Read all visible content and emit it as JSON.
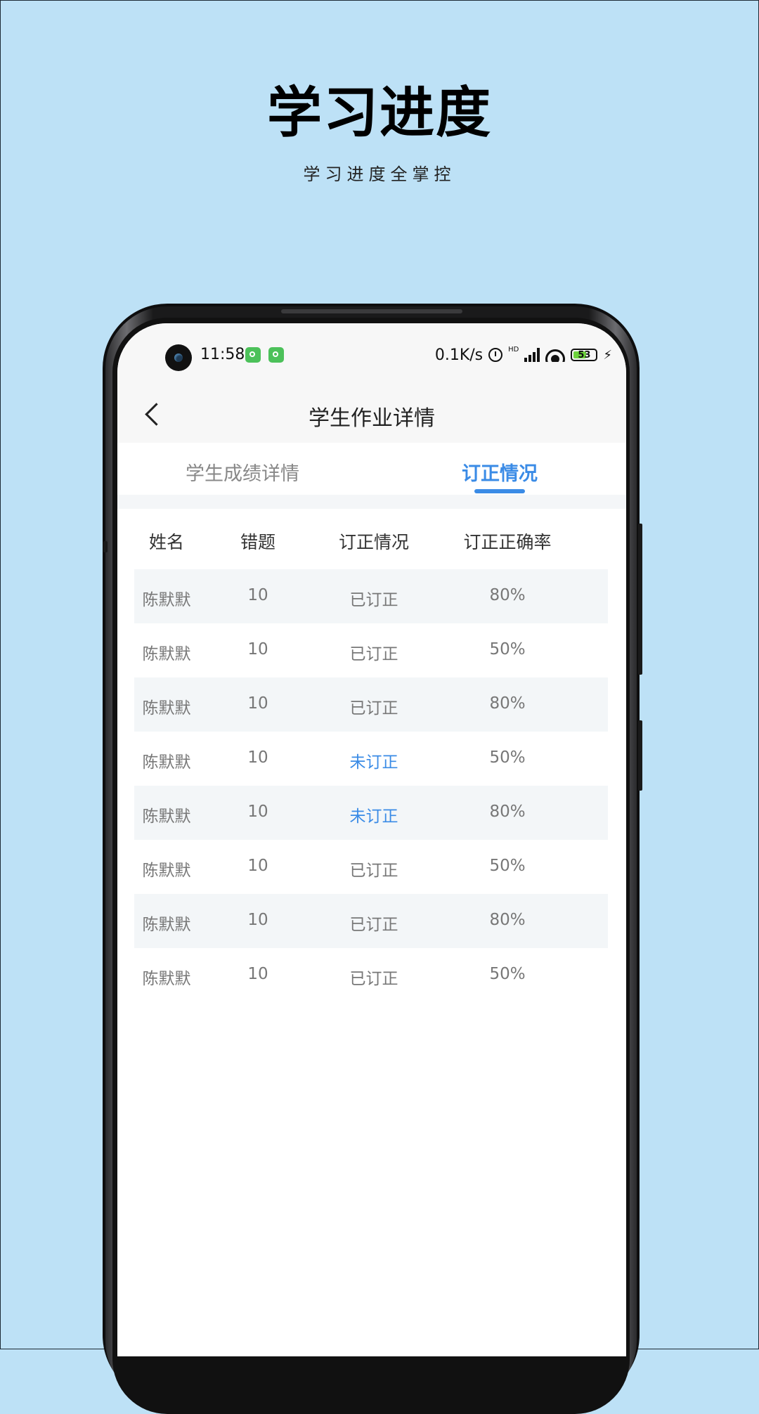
{
  "promo": {
    "title": "学习进度",
    "subtitle": "学习进度全掌控"
  },
  "status_bar": {
    "time": "11:58",
    "net_speed": "0.1K/s",
    "signal_label": "HD",
    "battery": "53"
  },
  "nav": {
    "title": "学生作业详情"
  },
  "tabs": [
    {
      "label": "学生成绩详情",
      "active": false
    },
    {
      "label": "订正情况",
      "active": true
    }
  ],
  "table": {
    "headers": [
      "姓名",
      "错题",
      "订正情况",
      "订正正确率"
    ],
    "rows": [
      {
        "name": "陈默默",
        "errors": "10",
        "status": "已订正",
        "rate": "80%"
      },
      {
        "name": "陈默默",
        "errors": "10",
        "status": "已订正",
        "rate": "50%"
      },
      {
        "name": "陈默默",
        "errors": "10",
        "status": "已订正",
        "rate": "80%"
      },
      {
        "name": "陈默默",
        "errors": "10",
        "status": "未订正",
        "rate": "50%"
      },
      {
        "name": "陈默默",
        "errors": "10",
        "status": "未订正",
        "rate": "80%"
      },
      {
        "name": "陈默默",
        "errors": "10",
        "status": "已订正",
        "rate": "50%"
      },
      {
        "name": "陈默默",
        "errors": "10",
        "status": "已订正",
        "rate": "80%"
      },
      {
        "name": "陈默默",
        "errors": "10",
        "status": "已订正",
        "rate": "50%"
      }
    ]
  },
  "colors": {
    "background": "#bde1f6",
    "accent": "#3a8be6",
    "row_shade": "#f3f6f8"
  }
}
